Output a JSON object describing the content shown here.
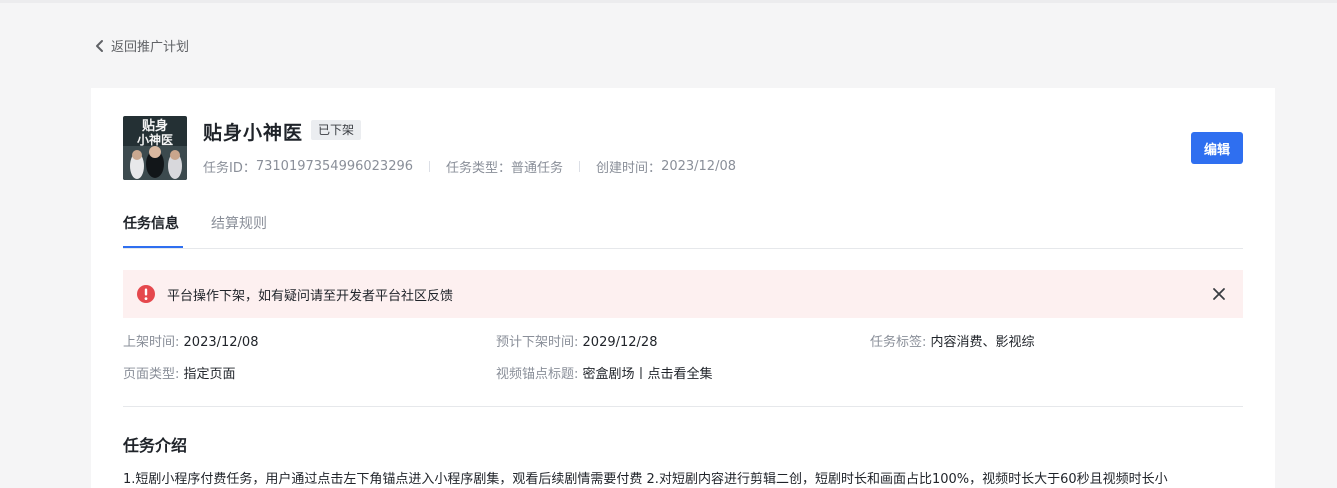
{
  "back_link": {
    "label": "返回推广计划"
  },
  "task": {
    "title": "贴身小神医",
    "status_badge": "已下架",
    "cover_text_line1": "贴身",
    "cover_text_line2": "小神医",
    "meta": [
      {
        "label": "任务ID：",
        "value": "7310197354996023296"
      },
      {
        "label": "任务类型：",
        "value": "普通任务"
      },
      {
        "label": "创建时间：",
        "value": "2023/12/08"
      }
    ],
    "edit_label": "编辑"
  },
  "tabs": [
    {
      "label": "任务信息",
      "active": true
    },
    {
      "label": "结算规则",
      "active": false
    }
  ],
  "alert": {
    "message": "平台操作下架，如有疑问请至开发者平台社区反馈",
    "color": "#e5484d"
  },
  "info": {
    "listing_time": {
      "label": "上架时间:",
      "value": "2023/12/08"
    },
    "delist_time": {
      "label": "预计下架时间:",
      "value": "2029/12/28"
    },
    "task_tags": {
      "label": "任务标签:",
      "value": "内容消费、影视综"
    },
    "page_type": {
      "label": "页面类型:",
      "value": "指定页面"
    },
    "anchor_title": {
      "label": "视频锚点标题:",
      "value": "密盒剧场丨点击看全集"
    }
  },
  "intro": {
    "title": "任务介绍",
    "text": "1.短剧小程序付费任务，用户通过点击左下角锚点进入小程序剧集，观看后续剧情需要付费 2.对短剧内容进行剪辑二创，短剧时长和画面占比100%，视频时长大于60秒且视频时长小"
  },
  "colors": {
    "accent": "#2f6ff0",
    "alert_bg": "#fdf0f0",
    "page_bg": "#f5f5f6"
  }
}
